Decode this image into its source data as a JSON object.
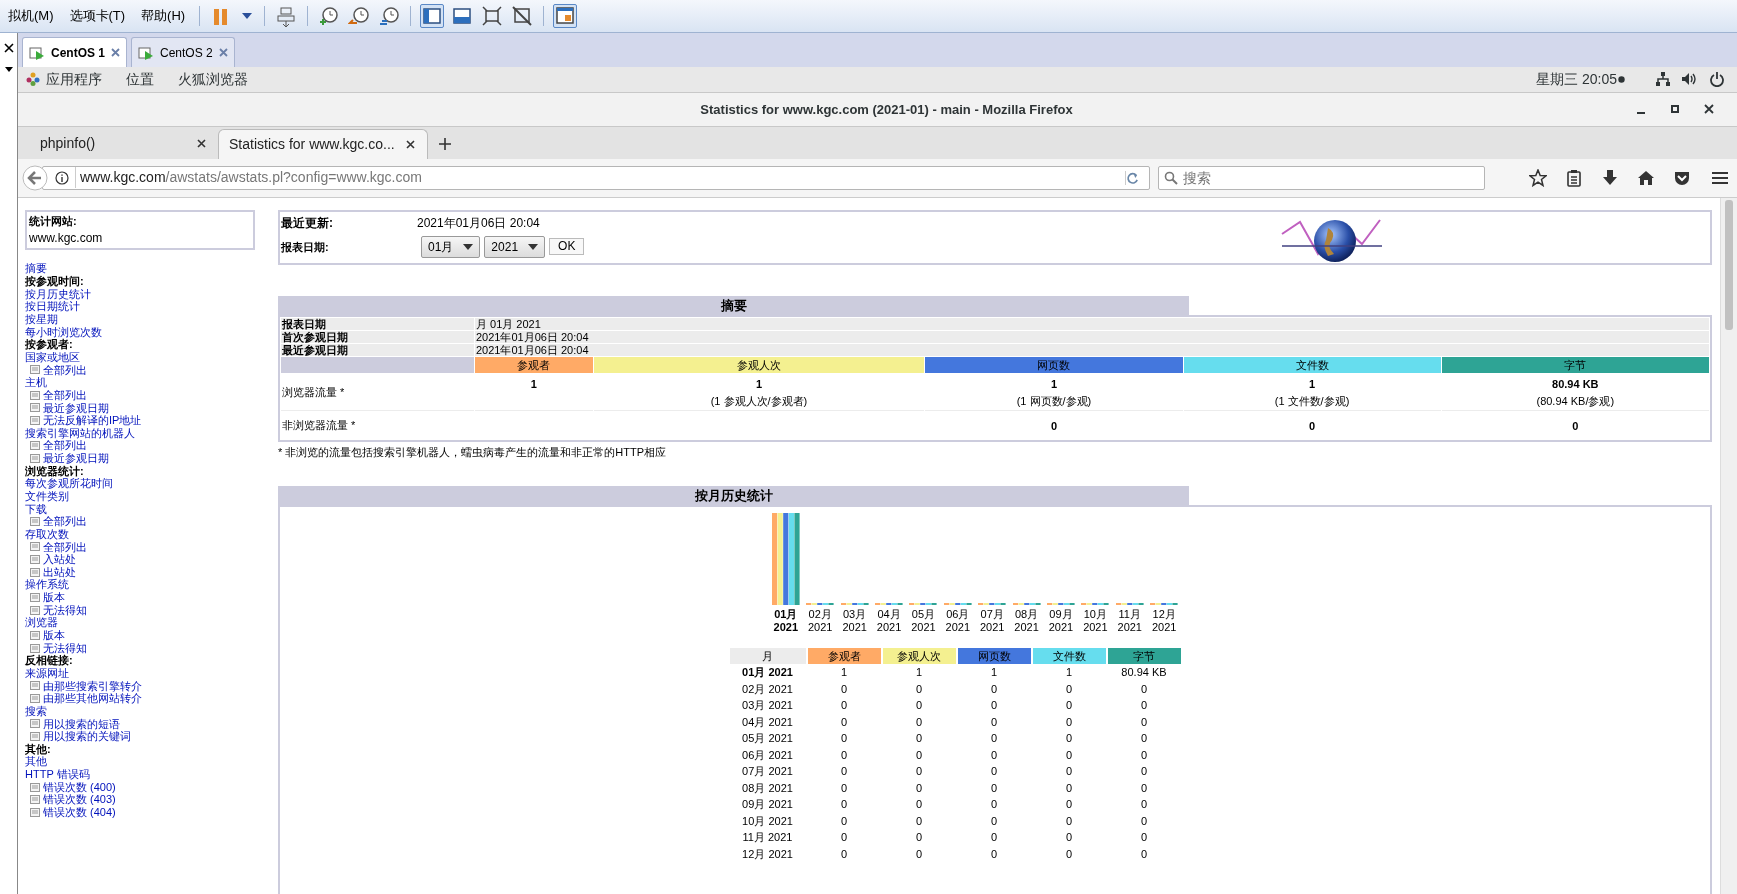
{
  "vmware": {
    "menus": [
      "拟机(M)",
      "选项卡(T)",
      "帮助(H)"
    ],
    "toolbar": [
      {
        "kind": "pause",
        "selected": false
      },
      {
        "kind": "caret",
        "selected": false
      },
      {
        "kind": "devices",
        "selected": false
      },
      {
        "kind": "snap-take",
        "selected": false
      },
      {
        "kind": "snap-revert",
        "selected": false
      },
      {
        "kind": "snap-manage",
        "selected": false
      },
      {
        "kind": "library",
        "selected": true
      },
      {
        "kind": "console",
        "selected": false
      },
      {
        "kind": "fullscreen",
        "selected": false
      },
      {
        "kind": "unity",
        "selected": false
      },
      {
        "kind": "thumbs",
        "selected": true
      }
    ],
    "tabs": [
      {
        "label": "CentOS 1",
        "selected": true
      },
      {
        "label": "CentOS 2",
        "selected": false
      }
    ]
  },
  "gnome": {
    "menus": [
      "应用程序",
      "位置",
      "火狐浏览器"
    ],
    "clock": "星期三 20:05"
  },
  "firefox": {
    "title": "Statistics for www.kgc.com (2021-01) - main - Mozilla Firefox",
    "tabs": [
      {
        "label": "phpinfo()",
        "selected": false
      },
      {
        "label": "Statistics for www.kgc.co...",
        "selected": true
      }
    ],
    "url": {
      "host": "www.kgc.com",
      "path": "/awstats/awstats.pl?config=www.kgc.com"
    },
    "search": {
      "placeholder": "搜索"
    }
  },
  "sidebar": {
    "site_label": "统计网站:",
    "site": "www.kgc.com",
    "items": [
      {
        "kind": "link",
        "label": "摘要"
      },
      {
        "kind": "heading",
        "label": "按参观时间:"
      },
      {
        "kind": "link",
        "label": "按月历史统计"
      },
      {
        "kind": "link",
        "label": "按日期统计"
      },
      {
        "kind": "link",
        "label": "按星期"
      },
      {
        "kind": "link",
        "label": "每小时浏览次数"
      },
      {
        "kind": "heading",
        "label": "按参观者:"
      },
      {
        "kind": "link",
        "label": "国家或地区",
        "children": [
          {
            "label": "全部列出"
          }
        ]
      },
      {
        "kind": "link",
        "label": "主机",
        "children": [
          {
            "label": "全部列出"
          },
          {
            "label": "最近参观日期"
          },
          {
            "label": "无法反解译的IP地址"
          }
        ]
      },
      {
        "kind": "link",
        "label": "搜索引擎网站的机器人",
        "children": [
          {
            "label": "全部列出"
          },
          {
            "label": "最近参观日期"
          }
        ]
      },
      {
        "kind": "heading",
        "label": "浏览器统计:"
      },
      {
        "kind": "link",
        "label": "每次参观所花时间"
      },
      {
        "kind": "link",
        "label": "文件类别"
      },
      {
        "kind": "link",
        "label": "下载",
        "children": [
          {
            "label": "全部列出"
          }
        ]
      },
      {
        "kind": "link",
        "label": "存取次数",
        "children": [
          {
            "label": "全部列出"
          },
          {
            "label": "入站处"
          },
          {
            "label": "出站处"
          }
        ]
      },
      {
        "kind": "link",
        "label": "操作系统",
        "children": [
          {
            "label": "版本"
          },
          {
            "label": "无法得知"
          }
        ]
      },
      {
        "kind": "link",
        "label": "浏览器",
        "children": [
          {
            "label": "版本"
          },
          {
            "label": "无法得知"
          }
        ]
      },
      {
        "kind": "heading",
        "label": "反相链接:"
      },
      {
        "kind": "link",
        "label": "来源网址",
        "children": [
          {
            "label": "由那些搜索引擎转介"
          },
          {
            "label": "由那些其他网站转介"
          }
        ]
      },
      {
        "kind": "link",
        "label": "搜索",
        "children": [
          {
            "label": "用以搜索的短语"
          },
          {
            "label": "用以搜索的关键词"
          }
        ]
      },
      {
        "kind": "heading",
        "label": "其他:"
      },
      {
        "kind": "link",
        "label": "其他"
      },
      {
        "kind": "link",
        "label": "HTTP 错误码",
        "children": [
          {
            "label": "错误次数 (400)"
          },
          {
            "label": "错误次数 (403)"
          },
          {
            "label": "错误次数 (404)"
          }
        ]
      }
    ]
  },
  "header": {
    "last_update_label": "最近更新:",
    "last_update": "2021年01月06日 20:04",
    "period_label": "报表日期:",
    "month": "01月",
    "year": "2021",
    "ok": "OK"
  },
  "summary": {
    "title": "摘要",
    "info": [
      {
        "label": "报表日期",
        "value": "月 01月 2021"
      },
      {
        "label": "首次参观日期",
        "value": "2021年01月06日 20:04"
      },
      {
        "label": "最近参观日期",
        "value": "2021年01月06日 20:04"
      }
    ],
    "columns": [
      {
        "label": "参观者",
        "color": "#ffaa66"
      },
      {
        "label": "参观人次",
        "color": "#f4f090"
      },
      {
        "label": "网页数",
        "color": "#4477dd"
      },
      {
        "label": "文件数",
        "color": "#66ddee"
      },
      {
        "label": "字节",
        "color": "#2ea495"
      }
    ],
    "rows": [
      {
        "label": "浏览器流量 *",
        "cells": [
          {
            "value": "1"
          },
          {
            "value": "1",
            "note": "(1 参观人次/参观者)"
          },
          {
            "value": "1",
            "note": "(1 网页数/参观)"
          },
          {
            "value": "1",
            "note": "(1 文件数/参观)"
          },
          {
            "value": "80.94 KB",
            "note": "(80.94 KB/参观)"
          }
        ]
      },
      {
        "label": "非浏览器流量 *",
        "cells": [
          {},
          {},
          {
            "value": "0"
          },
          {
            "value": "0"
          },
          {
            "value": "0"
          }
        ]
      }
    ],
    "footnote": "* 非浏览的流量包括搜索引擎机器人，蠕虫病毒产生的流量和非正常的HTTP相应"
  },
  "monthly": {
    "title": "按月历史统计",
    "chart_months": [
      {
        "month": "01月",
        "year": "2021",
        "selected": true
      },
      {
        "month": "02月",
        "year": "2021",
        "selected": false
      },
      {
        "month": "03月",
        "year": "2021",
        "selected": false
      },
      {
        "month": "04月",
        "year": "2021",
        "selected": false
      },
      {
        "month": "05月",
        "year": "2021",
        "selected": false
      },
      {
        "month": "06月",
        "year": "2021",
        "selected": false
      },
      {
        "month": "07月",
        "year": "2021",
        "selected": false
      },
      {
        "month": "08月",
        "year": "2021",
        "selected": false
      },
      {
        "month": "09月",
        "year": "2021",
        "selected": false
      },
      {
        "month": "10月",
        "year": "2021",
        "selected": false
      },
      {
        "month": "11月",
        "year": "2021",
        "selected": false
      },
      {
        "month": "12月",
        "year": "2021",
        "selected": false
      }
    ],
    "month_header": "月",
    "columns": [
      {
        "label": "参观者",
        "color": "#ffaa66"
      },
      {
        "label": "参观人次",
        "color": "#f4f090"
      },
      {
        "label": "网页数",
        "color": "#4477dd"
      },
      {
        "label": "文件数",
        "color": "#66ddee"
      },
      {
        "label": "字节",
        "color": "#2ea495"
      }
    ],
    "rows": [
      {
        "month": "01月 2021",
        "selected": true,
        "values": [
          "1",
          "1",
          "1",
          "1",
          "80.94 KB"
        ]
      },
      {
        "month": "02月 2021",
        "selected": false,
        "values": [
          "0",
          "0",
          "0",
          "0",
          "0"
        ]
      },
      {
        "month": "03月 2021",
        "selected": false,
        "values": [
          "0",
          "0",
          "0",
          "0",
          "0"
        ]
      },
      {
        "month": "04月 2021",
        "selected": false,
        "values": [
          "0",
          "0",
          "0",
          "0",
          "0"
        ]
      },
      {
        "month": "05月 2021",
        "selected": false,
        "values": [
          "0",
          "0",
          "0",
          "0",
          "0"
        ]
      },
      {
        "month": "06月 2021",
        "selected": false,
        "values": [
          "0",
          "0",
          "0",
          "0",
          "0"
        ]
      },
      {
        "month": "07月 2021",
        "selected": false,
        "values": [
          "0",
          "0",
          "0",
          "0",
          "0"
        ]
      },
      {
        "month": "08月 2021",
        "selected": false,
        "values": [
          "0",
          "0",
          "0",
          "0",
          "0"
        ]
      },
      {
        "month": "09月 2021",
        "selected": false,
        "values": [
          "0",
          "0",
          "0",
          "0",
          "0"
        ]
      },
      {
        "month": "10月 2021",
        "selected": false,
        "values": [
          "0",
          "0",
          "0",
          "0",
          "0"
        ]
      },
      {
        "month": "11月 2021",
        "selected": false,
        "values": [
          "0",
          "0",
          "0",
          "0",
          "0"
        ]
      },
      {
        "month": "12月 2021",
        "selected": false,
        "values": [
          "0",
          "0",
          "0",
          "0",
          "0"
        ]
      }
    ]
  }
}
